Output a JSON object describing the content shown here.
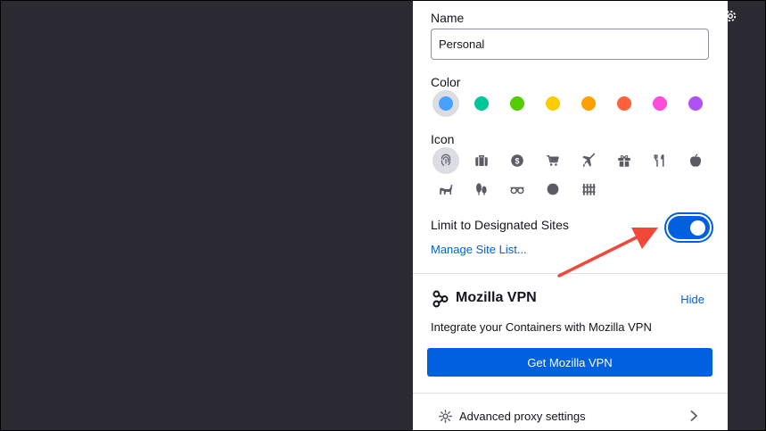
{
  "name": {
    "label": "Name",
    "value": "Personal"
  },
  "color": {
    "label": "Color",
    "options": [
      "#45a1ff",
      "#00c79a",
      "#51cd00",
      "#ffcb00",
      "#ff9f00",
      "#ff613d",
      "#ff4bda",
      "#af51f5"
    ],
    "selected_index": 0
  },
  "icon": {
    "label": "Icon",
    "options": [
      "fingerprint-icon",
      "briefcase-icon",
      "dollar-icon",
      "cart-icon",
      "plane-icon",
      "gift-icon",
      "food-icon",
      "fruit-icon",
      "pet-icon",
      "tree-icon",
      "chill-icon",
      "circle-icon",
      "fence-icon"
    ],
    "selected_index": 0
  },
  "limit": {
    "label": "Limit to Designated Sites",
    "enabled": true,
    "manage_link": "Manage Site List..."
  },
  "vpn": {
    "title": "Mozilla VPN",
    "hide_label": "Hide",
    "description": "Integrate your Containers with Mozilla VPN",
    "button_label": "Get Mozilla VPN"
  },
  "advanced": {
    "label": "Advanced proxy settings"
  },
  "colors_ui": {
    "accent": "#0060df",
    "icon_gray": "#5b5b66",
    "annotation_arrow": "#f2483a"
  }
}
